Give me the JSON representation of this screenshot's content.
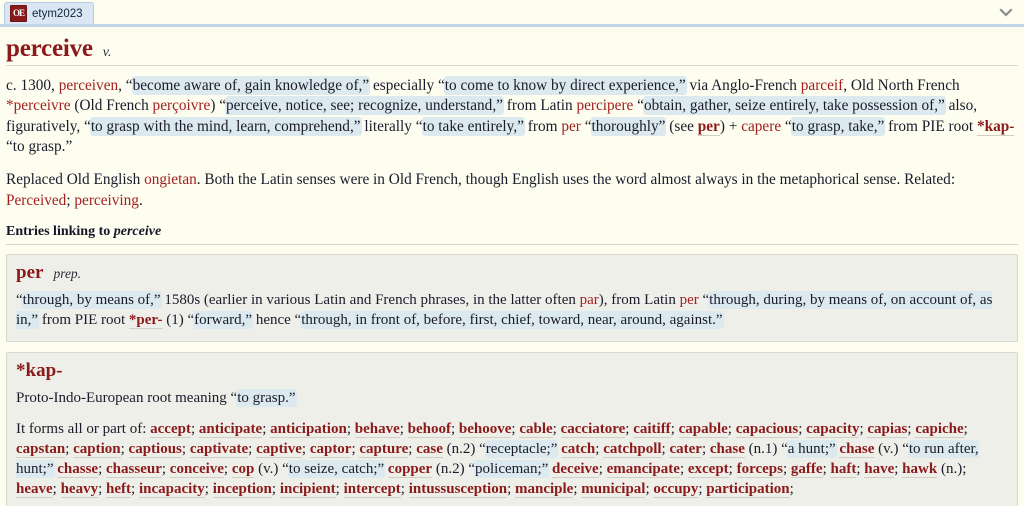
{
  "browser": {
    "tab": {
      "title": "etym2023",
      "favicon_text": "OE",
      "favicon_color": "#8b1a1a"
    },
    "tab_list_chevron": "chevron-down-icon"
  },
  "colors": {
    "page_background": "#fdfdf0",
    "link": "#a32020",
    "headword": "#8b1a1a",
    "highlight": "#dceaf0",
    "card_background": "#efefea"
  },
  "entry": {
    "headword": "perceive",
    "part_of_speech": "v.",
    "paragraph1": [
      {
        "t": "c. 1300, ",
        "s": "plain"
      },
      {
        "t": "perceiven",
        "s": "link"
      },
      {
        "t": ", “",
        "s": "plain"
      },
      {
        "t": "become aware of, gain knowledge of,”",
        "s": "hl"
      },
      {
        "t": " especially “",
        "s": "plain"
      },
      {
        "t": "to come to know by direct experience,”",
        "s": "hl"
      },
      {
        "t": " via Anglo-French ",
        "s": "plain"
      },
      {
        "t": "parceif",
        "s": "link"
      },
      {
        "t": ", Old North French ",
        "s": "plain"
      },
      {
        "t": "*perceivre",
        "s": "link"
      },
      {
        "t": " (Old French ",
        "s": "plain"
      },
      {
        "t": "perçoivre",
        "s": "link"
      },
      {
        "t": ") “",
        "s": "plain"
      },
      {
        "t": "perceive, notice, see; recognize, understand,”",
        "s": "hl"
      },
      {
        "t": " from Latin ",
        "s": "plain"
      },
      {
        "t": "percipere",
        "s": "link"
      },
      {
        "t": " “",
        "s": "plain"
      },
      {
        "t": "obtain, gather, seize entirely, take possession of,”",
        "s": "hl"
      },
      {
        "t": " also, figuratively, “",
        "s": "plain"
      },
      {
        "t": "to grasp with the mind, learn, comprehend,”",
        "s": "hl"
      },
      {
        "t": " literally “",
        "s": "plain"
      },
      {
        "t": "to take entirely,”",
        "s": "hl"
      },
      {
        "t": " from ",
        "s": "plain"
      },
      {
        "t": "per",
        "s": "link"
      },
      {
        "t": " “",
        "s": "plain"
      },
      {
        "t": "thoroughly”",
        "s": "hl"
      },
      {
        "t": " (see ",
        "s": "plain"
      },
      {
        "t": "per",
        "s": "linkb"
      },
      {
        "t": ") + ",
        "s": "plain"
      },
      {
        "t": "capere",
        "s": "link"
      },
      {
        "t": " “",
        "s": "plain"
      },
      {
        "t": "to grasp, take,”",
        "s": "hl"
      },
      {
        "t": " from PIE root ",
        "s": "plain"
      },
      {
        "t": "*kap-",
        "s": "linkb"
      },
      {
        "t": " “to grasp.”",
        "s": "plain"
      }
    ],
    "paragraph2": [
      {
        "t": "Replaced Old English ",
        "s": "plain"
      },
      {
        "t": "ongietan",
        "s": "link"
      },
      {
        "t": ". Both the Latin senses were in Old French, though English uses the word almost always in the metaphorical sense. Related: ",
        "s": "plain"
      },
      {
        "t": "Perceived",
        "s": "link"
      },
      {
        "t": "; ",
        "s": "plain"
      },
      {
        "t": "perceiving",
        "s": "link"
      },
      {
        "t": ".",
        "s": "plain"
      }
    ]
  },
  "linking_section": {
    "label_prefix": "Entries linking to ",
    "label_word": "perceive"
  },
  "cards": [
    {
      "word": "per",
      "part_of_speech": "prep.",
      "body": [
        {
          "t": "“",
          "s": "plain"
        },
        {
          "t": "through, by means of,”",
          "s": "hl"
        },
        {
          "t": " 1580s (earlier in various Latin and French phrases, in the latter often ",
          "s": "plain"
        },
        {
          "t": "par",
          "s": "link"
        },
        {
          "t": "), from Latin ",
          "s": "plain"
        },
        {
          "t": "per",
          "s": "link"
        },
        {
          "t": " “",
          "s": "plain"
        },
        {
          "t": "through, during, by means of, on account of, as in,”",
          "s": "hl"
        },
        {
          "t": " from PIE root ",
          "s": "plain"
        },
        {
          "t": "*per-",
          "s": "linkb"
        },
        {
          "t": " (1) “",
          "s": "plain"
        },
        {
          "t": "forward,”",
          "s": "hl"
        },
        {
          "t": " hence “",
          "s": "plain"
        },
        {
          "t": "through, in front of, before, first, chief, toward, near, around, against.”",
          "s": "hl"
        }
      ]
    },
    {
      "word": "*kap-",
      "part_of_speech": "",
      "body": [
        {
          "t": "Proto-Indo-European root meaning “",
          "s": "plain"
        },
        {
          "t": "to grasp.”",
          "s": "hl"
        }
      ],
      "body2_prefix": "It forms all or part of: ",
      "word_list": [
        {
          "t": "accept",
          "s": "linkb"
        },
        {
          "t": "; ",
          "s": "plain"
        },
        {
          "t": "anticipate",
          "s": "linkb"
        },
        {
          "t": "; ",
          "s": "plain"
        },
        {
          "t": "anticipation",
          "s": "linkb"
        },
        {
          "t": "; ",
          "s": "plain"
        },
        {
          "t": "behave",
          "s": "linkb"
        },
        {
          "t": "; ",
          "s": "plain"
        },
        {
          "t": "behoof",
          "s": "linkb"
        },
        {
          "t": "; ",
          "s": "plain"
        },
        {
          "t": "behoove",
          "s": "linkb"
        },
        {
          "t": "; ",
          "s": "plain"
        },
        {
          "t": "cable",
          "s": "linkb"
        },
        {
          "t": "; ",
          "s": "plain"
        },
        {
          "t": "cacciatore",
          "s": "linkb"
        },
        {
          "t": "; ",
          "s": "plain"
        },
        {
          "t": "caitiff",
          "s": "linkb"
        },
        {
          "t": "; ",
          "s": "plain"
        },
        {
          "t": "capable",
          "s": "linkb"
        },
        {
          "t": "; ",
          "s": "plain"
        },
        {
          "t": "capacious",
          "s": "linkb"
        },
        {
          "t": "; ",
          "s": "plain"
        },
        {
          "t": "capacity",
          "s": "linkb"
        },
        {
          "t": "; ",
          "s": "plain"
        },
        {
          "t": "capias",
          "s": "linkb"
        },
        {
          "t": "; ",
          "s": "plain"
        },
        {
          "t": "capiche",
          "s": "linkb"
        },
        {
          "t": "; ",
          "s": "plain"
        },
        {
          "t": "capstan",
          "s": "linkb"
        },
        {
          "t": "; ",
          "s": "plain"
        },
        {
          "t": "caption",
          "s": "linkb"
        },
        {
          "t": "; ",
          "s": "plain"
        },
        {
          "t": "captious",
          "s": "linkb"
        },
        {
          "t": "; ",
          "s": "plain"
        },
        {
          "t": "captivate",
          "s": "linkb"
        },
        {
          "t": "; ",
          "s": "plain"
        },
        {
          "t": "captive",
          "s": "linkb"
        },
        {
          "t": "; ",
          "s": "plain"
        },
        {
          "t": "captor",
          "s": "linkb"
        },
        {
          "t": "; ",
          "s": "plain"
        },
        {
          "t": "capture",
          "s": "linkb"
        },
        {
          "t": "; ",
          "s": "plain"
        },
        {
          "t": "case",
          "s": "linkb"
        },
        {
          "t": " (n.2) “",
          "s": "plain"
        },
        {
          "t": "receptacle;”",
          "s": "hl"
        },
        {
          "t": " ",
          "s": "plain"
        },
        {
          "t": "catch",
          "s": "linkb"
        },
        {
          "t": "; ",
          "s": "plain"
        },
        {
          "t": "catchpoll",
          "s": "linkb"
        },
        {
          "t": "; ",
          "s": "plain"
        },
        {
          "t": "cater",
          "s": "linkb"
        },
        {
          "t": "; ",
          "s": "plain"
        },
        {
          "t": "chase",
          "s": "linkb"
        },
        {
          "t": " (n.1) “",
          "s": "plain"
        },
        {
          "t": "a hunt;”",
          "s": "hl"
        },
        {
          "t": " ",
          "s": "plain"
        },
        {
          "t": "chase",
          "s": "linkb"
        },
        {
          "t": " (v.) “",
          "s": "plain"
        },
        {
          "t": "to run after, hunt;”",
          "s": "hl"
        },
        {
          "t": " ",
          "s": "plain"
        },
        {
          "t": "chasse",
          "s": "linkb"
        },
        {
          "t": "; ",
          "s": "plain"
        },
        {
          "t": "chasseur",
          "s": "linkb"
        },
        {
          "t": "; ",
          "s": "plain"
        },
        {
          "t": "conceive",
          "s": "linkb"
        },
        {
          "t": "; ",
          "s": "plain"
        },
        {
          "t": "cop",
          "s": "linkb"
        },
        {
          "t": " (v.) “",
          "s": "plain"
        },
        {
          "t": "to seize, catch;”",
          "s": "hl"
        },
        {
          "t": " ",
          "s": "plain"
        },
        {
          "t": "copper",
          "s": "linkb"
        },
        {
          "t": " (n.2) “",
          "s": "plain"
        },
        {
          "t": "policeman;”",
          "s": "hl"
        },
        {
          "t": " ",
          "s": "plain"
        },
        {
          "t": "deceive",
          "s": "linkb"
        },
        {
          "t": "; ",
          "s": "plain"
        },
        {
          "t": "emancipate",
          "s": "linkb"
        },
        {
          "t": "; ",
          "s": "plain"
        },
        {
          "t": "except",
          "s": "linkb"
        },
        {
          "t": "; ",
          "s": "plain"
        },
        {
          "t": "forceps",
          "s": "linkb"
        },
        {
          "t": "; ",
          "s": "plain"
        },
        {
          "t": "gaffe",
          "s": "linkb"
        },
        {
          "t": "; ",
          "s": "plain"
        },
        {
          "t": "haft",
          "s": "linkb"
        },
        {
          "t": "; ",
          "s": "plain"
        },
        {
          "t": "have",
          "s": "linkb"
        },
        {
          "t": "; ",
          "s": "plain"
        },
        {
          "t": "hawk",
          "s": "linkb"
        },
        {
          "t": " (n.); ",
          "s": "plain"
        },
        {
          "t": "heave",
          "s": "linkb"
        },
        {
          "t": "; ",
          "s": "plain"
        },
        {
          "t": "heavy",
          "s": "linkb"
        },
        {
          "t": "; ",
          "s": "plain"
        },
        {
          "t": "heft",
          "s": "linkb"
        },
        {
          "t": "; ",
          "s": "plain"
        },
        {
          "t": "incapacity",
          "s": "linkb"
        },
        {
          "t": "; ",
          "s": "plain"
        },
        {
          "t": "inception",
          "s": "linkb"
        },
        {
          "t": "; ",
          "s": "plain"
        },
        {
          "t": "incipient",
          "s": "linkb"
        },
        {
          "t": "; ",
          "s": "plain"
        },
        {
          "t": "intercept",
          "s": "linkb"
        },
        {
          "t": "; ",
          "s": "plain"
        },
        {
          "t": "intussusception",
          "s": "linkb"
        },
        {
          "t": "; ",
          "s": "plain"
        },
        {
          "t": "manciple",
          "s": "linkb"
        },
        {
          "t": "; ",
          "s": "plain"
        },
        {
          "t": "municipal",
          "s": "linkb"
        },
        {
          "t": "; ",
          "s": "plain"
        },
        {
          "t": "occupy",
          "s": "linkb"
        },
        {
          "t": "; ",
          "s": "plain"
        },
        {
          "t": "participation",
          "s": "linkb"
        },
        {
          "t": ";",
          "s": "plain"
        }
      ]
    }
  ]
}
